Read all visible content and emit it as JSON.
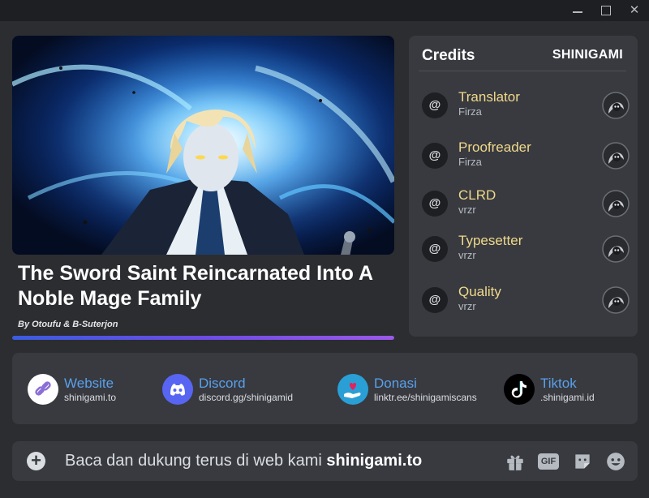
{
  "window": {
    "controls": [
      "minimize-icon",
      "maximize-icon",
      "close-icon"
    ],
    "close_glyph": "✕"
  },
  "cover": {
    "title": "The Sword Saint Reincarnated Into A Noble Mage Family",
    "byline": "By Otoufu & B-Suterjon",
    "progress_fraction": 1.0
  },
  "credits": {
    "heading": "Credits",
    "brand": "SHINIGAMI",
    "at_symbol": "@",
    "rows": [
      {
        "role": "Translator",
        "name": "Firza"
      },
      {
        "role": "Proofreader",
        "name": "Firza"
      },
      {
        "role": "CLRD",
        "name": "vrzr"
      },
      {
        "role": "Typesetter",
        "name": "vrzr"
      },
      {
        "role": "Quality",
        "name": "vrzr"
      }
    ]
  },
  "links": [
    {
      "name": "Website",
      "url": "shinigami.to",
      "icon": "link-icon",
      "color": "#ffffff"
    },
    {
      "name": "Discord",
      "url": "discord.gg/shinigamid",
      "icon": "discord-icon",
      "color": "#5865f2"
    },
    {
      "name": "Donasi",
      "url": "linktr.ee/shinigamiscans",
      "icon": "donate-icon",
      "color": "#2a9fd6"
    },
    {
      "name": "Tiktok",
      "url": ".shinigami.id",
      "icon": "tiktok-icon",
      "color": "#000000"
    }
  ],
  "chat": {
    "plus": "+",
    "message_prefix": "Baca dan dukung terus di web kami ",
    "message_bold": "shinigami.to",
    "icons": [
      "gift-icon",
      "gif-icon",
      "sticker-icon",
      "emoji-icon"
    ],
    "gif_label": "GIF"
  },
  "colors": {
    "background": "#2b2d31",
    "panel": "#383a40",
    "role": "#f0d98a",
    "link": "#5aa0ea"
  }
}
